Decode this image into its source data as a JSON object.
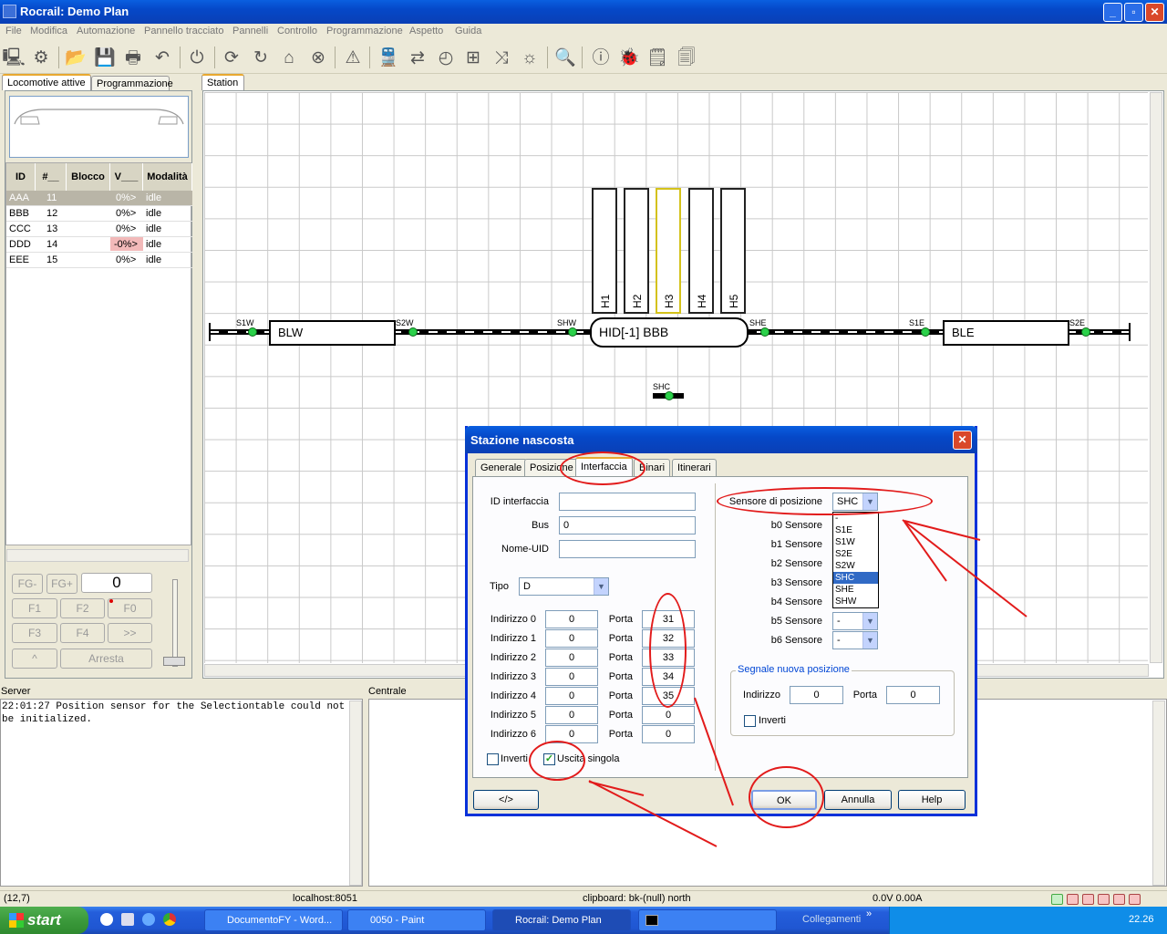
{
  "window": {
    "title": "Rocrail: Demo Plan"
  },
  "menu": [
    "File",
    "Modifica",
    "Automazione",
    "Pannello tracciato",
    "Pannelli",
    "Controllo",
    "Programmazione",
    "Aspetto",
    "Guida"
  ],
  "left_tabs": [
    "Locomotive attive",
    "Programmazione"
  ],
  "loco_table": {
    "headers": [
      "ID",
      "#__",
      "Blocco",
      "V___",
      "Modalità"
    ],
    "rows": [
      {
        "id": "AAA",
        "num": "11",
        "block": "",
        "v": "0%>",
        "mode": "idle"
      },
      {
        "id": "BBB",
        "num": "12",
        "block": "",
        "v": "0%>",
        "mode": "idle"
      },
      {
        "id": "CCC",
        "num": "13",
        "block": "",
        "v": "0%>",
        "mode": "idle"
      },
      {
        "id": "DDD",
        "num": "14",
        "block": "",
        "v": "-0%>",
        "mode": "idle"
      },
      {
        "id": "EEE",
        "num": "15",
        "block": "",
        "v": "0%>",
        "mode": "idle"
      }
    ]
  },
  "controls": {
    "fg_minus": "FG-",
    "fg_plus": "FG+",
    "speed": "0",
    "f1": "F1",
    "f2": "F2",
    "f0": "F0",
    "f3": "F3",
    "f4": "F4",
    "more": ">>",
    "caret": "^",
    "stop": "Arresta"
  },
  "plan": {
    "tab": "Station",
    "blocks": {
      "blw": "BLW",
      "ble": "BLE",
      "hid": "HID[-1] BBB"
    },
    "tracks": [
      "H1",
      "H2",
      "H3",
      "H4",
      "H5"
    ],
    "sensors": {
      "s1w": "S1W",
      "s2w": "S2W",
      "shw": "SHW",
      "she": "SHE",
      "s1e": "S1E",
      "s2e": "S2E",
      "shc": "SHC"
    }
  },
  "panes": {
    "server": "Server",
    "centrale": "Centrale",
    "log": "22:01:27 Position sensor for the Selectiontable could not be initialized."
  },
  "statusbar": {
    "coords": "(12,7)",
    "host": "localhost:8051",
    "clipboard": "clipboard: bk-(null) north",
    "power": "0.0V 0.00A"
  },
  "taskbar": {
    "start": "start",
    "tasks": [
      "DocumentoFY - Word...",
      "0050 - Paint",
      "Rocrail: Demo Plan",
      ""
    ],
    "links": "Collegamenti",
    "clock": "22.26"
  },
  "dialog": {
    "title": "Stazione nascosta",
    "tabs": [
      "Generale",
      "Posizione",
      "Interfaccia",
      "Binari",
      "Itinerari"
    ],
    "id_interface_label": "ID interfaccia",
    "id_interface_value": "",
    "bus_label": "Bus",
    "bus_value": "0",
    "uid_label": "Nome-UID",
    "uid_value": "",
    "tipo_label": "Tipo",
    "tipo_value": "D",
    "address_rows": [
      {
        "label": "Indirizzo 0",
        "addr": "0",
        "port_label": "Porta",
        "port": "31"
      },
      {
        "label": "Indirizzo 1",
        "addr": "0",
        "port_label": "Porta",
        "port": "32"
      },
      {
        "label": "Indirizzo 2",
        "addr": "0",
        "port_label": "Porta",
        "port": "33"
      },
      {
        "label": "Indirizzo 3",
        "addr": "0",
        "port_label": "Porta",
        "port": "34"
      },
      {
        "label": "Indirizzo 4",
        "addr": "0",
        "port_label": "Porta",
        "port": "35"
      },
      {
        "label": "Indirizzo 5",
        "addr": "0",
        "port_label": "Porta",
        "port": "0"
      },
      {
        "label": "Indirizzo 6",
        "addr": "0",
        "port_label": "Porta",
        "port": "0"
      }
    ],
    "invert_label": "Inverti",
    "single_output_label": "Uscita singola",
    "pos_sensor_label": "Sensore di posizione",
    "pos_sensor_value": "SHC",
    "sensor_rows": [
      {
        "label": "b0 Sensore",
        "value": ""
      },
      {
        "label": "b1 Sensore",
        "value": ""
      },
      {
        "label": "b2 Sensore",
        "value": ""
      },
      {
        "label": "b3 Sensore",
        "value": ""
      },
      {
        "label": "b4 Sensore",
        "value": ""
      },
      {
        "label": "b5 Sensore",
        "value": "-"
      },
      {
        "label": "b6 Sensore",
        "value": "-"
      }
    ],
    "dropdown_options": [
      "-",
      "S1E",
      "S1W",
      "S2E",
      "S2W",
      "SHC",
      "SHE",
      "SHW"
    ],
    "dropdown_selected": "SHC",
    "new_pos_signal_label": "Segnale nuova posizione",
    "sig_addr_label": "Indirizzo",
    "sig_addr_value": "0",
    "sig_port_label": "Porta",
    "sig_port_value": "0",
    "sig_invert_label": "Inverti",
    "buttons": {
      "xml": "</>",
      "ok": "OK",
      "cancel": "Annulla",
      "help": "Help"
    }
  },
  "colors": {
    "annotation": "#e21b1b",
    "title_blue": "#0548c8",
    "sensor_green": "#2bd14a"
  }
}
